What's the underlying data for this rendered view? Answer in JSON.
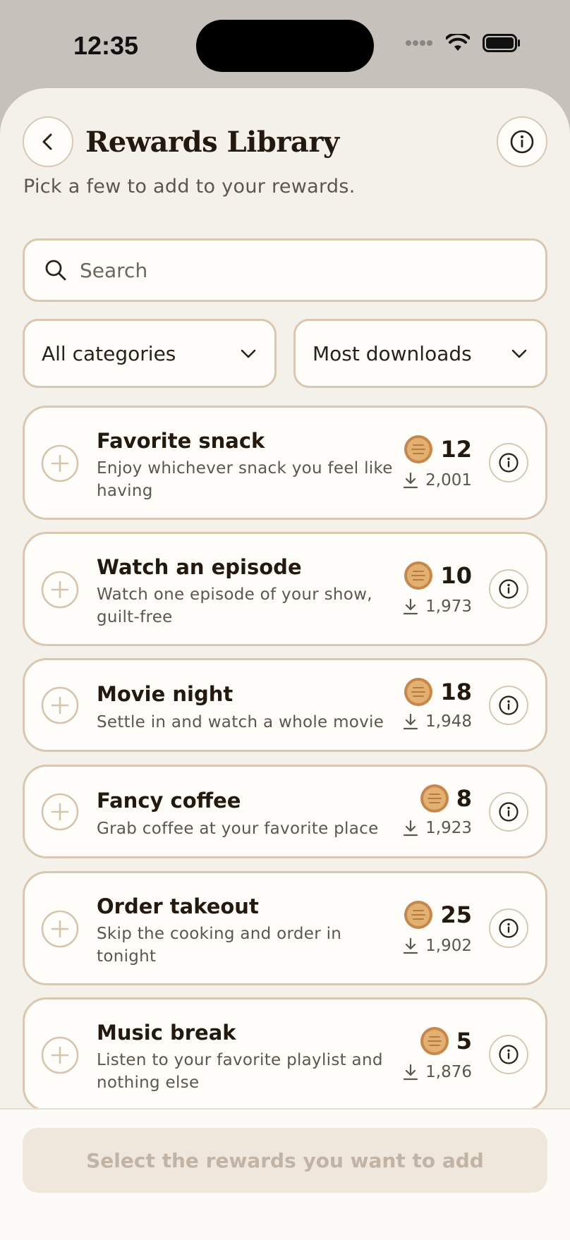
{
  "status_bar": {
    "time": "12:35"
  },
  "header": {
    "title": "Rewards Library",
    "subtitle": "Pick a few to add to your rewards."
  },
  "search": {
    "placeholder": "Search",
    "value": ""
  },
  "filters": {
    "category": "All categories",
    "sort": "Most downloads"
  },
  "colors": {
    "sheet_background": "#f4f0ea",
    "card_border": "#d9c7b2",
    "coin": "#d9a35c",
    "cta_background": "#efe6dc",
    "cta_text": "#c2b4a4"
  },
  "rewards": [
    {
      "title": "Favorite snack",
      "description": "Enjoy whichever snack you feel like having",
      "points": "12",
      "downloads": "2,001"
    },
    {
      "title": "Watch an episode",
      "description": "Watch one episode of your show, guilt-free",
      "points": "10",
      "downloads": "1,973"
    },
    {
      "title": "Movie night",
      "description": "Settle in and watch a whole movie",
      "points": "18",
      "downloads": "1,948"
    },
    {
      "title": "Fancy coffee",
      "description": "Grab coffee at your favorite place",
      "points": "8",
      "downloads": "1,923"
    },
    {
      "title": "Order takeout",
      "description": "Skip the cooking and order in tonight",
      "points": "25",
      "downloads": "1,902"
    },
    {
      "title": "Music break",
      "description": "Listen to your favorite playlist and nothing else",
      "points": "5",
      "downloads": "1,876"
    }
  ],
  "footer": {
    "cta_label": "Select the rewards you want to add"
  },
  "icons": {
    "back": "chevron-left-icon",
    "info": "info-icon",
    "search": "search-icon",
    "dropdown": "chevron-down-icon",
    "add": "plus-circle-icon",
    "coin": "coin-icon",
    "download": "download-icon"
  }
}
